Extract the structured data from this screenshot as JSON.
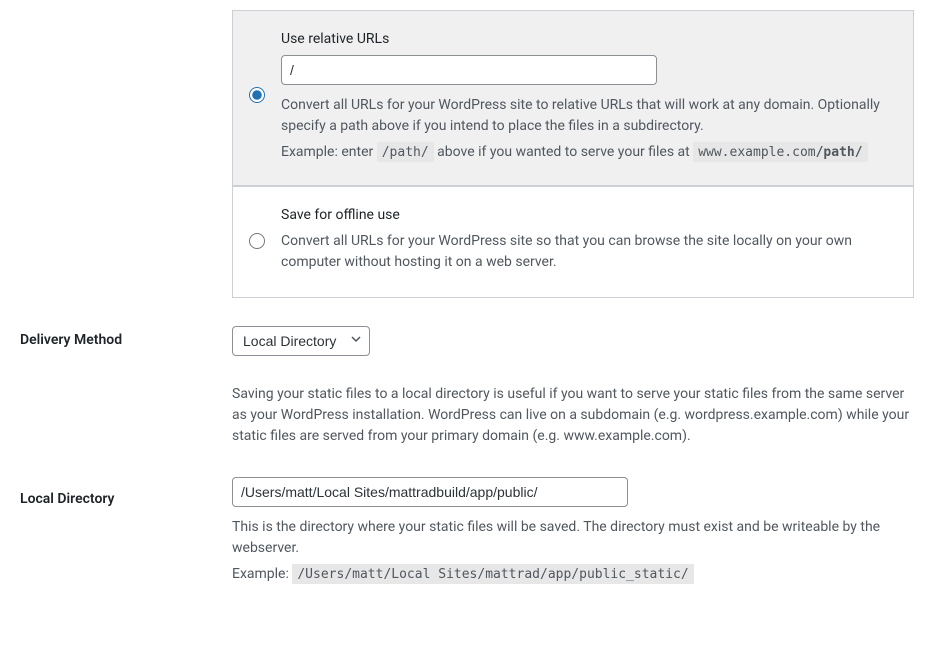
{
  "url_options": {
    "relative": {
      "title": "Use relative URLs",
      "input_value": "/",
      "desc": "Convert all URLs for your WordPress site to relative URLs that will work at any domain. Optionally specify a path above if you intend to place the files in a subdirectory.",
      "example_prefix": "Example: enter ",
      "example_code1": "/path/",
      "example_mid": " above if you wanted to serve your files at ",
      "example_code2_prefix": "www.example.com",
      "example_code2_bold": "/path/"
    },
    "offline": {
      "title": "Save for offline use",
      "desc": "Convert all URLs for your WordPress site so that you can browse the site locally on your own computer without hosting it on a web server."
    }
  },
  "delivery": {
    "label": "Delivery Method",
    "selected": "Local Directory",
    "desc": "Saving your static files to a local directory is useful if you want to serve your static files from the same server as your WordPress installation. WordPress can live on a subdomain (e.g. wordpress.example.com) while your static files are served from your primary domain (e.g. www.example.com)."
  },
  "local_directory": {
    "label": "Local Directory",
    "input_value": "/Users/matt/Local Sites/mattradbuild/app/public/",
    "desc": "This is the directory where your static files will be saved. The directory must exist and be writeable by the webserver.",
    "example_prefix": "Example: ",
    "example_code": "/Users/matt/Local Sites/mattrad/app/public_static/"
  }
}
